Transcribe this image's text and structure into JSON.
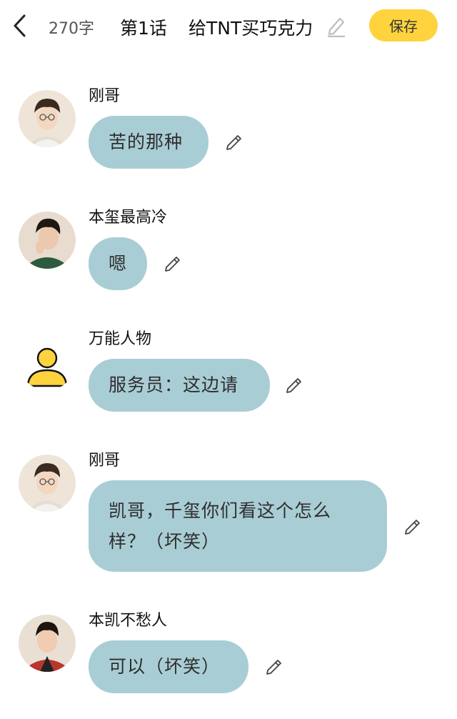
{
  "header": {
    "word_count": "270字",
    "episode": "第1话",
    "title": "给TNT买巧克力",
    "save_label": "保存"
  },
  "messages": [
    {
      "name": "刚哥",
      "avatar": "boy-glasses-avatar",
      "text": "苦的那种"
    },
    {
      "name": "本玺最高冷",
      "avatar": "boy-green-sweater-avatar",
      "text": "嗯"
    },
    {
      "name": "万能人物",
      "avatar": "generic-user-icon",
      "text": "服务员：这边请"
    },
    {
      "name": "刚哥",
      "avatar": "boy-glasses-avatar",
      "text": "凯哥，千玺你们看这个怎么样？（坏笑）"
    },
    {
      "name": "本凯不愁人",
      "avatar": "boy-red-jacket-avatar",
      "text": "可以（坏笑）"
    }
  ],
  "colors": {
    "bubble": "#a9cdd5",
    "save_button": "#ffd33d",
    "generic_user_icon": "#ffd33d"
  }
}
